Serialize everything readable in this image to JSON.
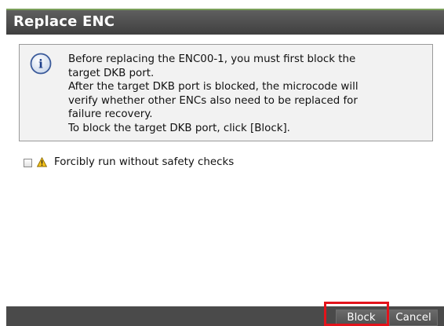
{
  "dialog": {
    "title": "Replace ENC",
    "info_icon": "info-icon",
    "message_lines": [
      "Before replacing the ENC00-1, you must first block the",
      "target DKB port.",
      "After the target DKB port is blocked, the microcode will",
      "verify whether other ENCs also need to be replaced for",
      "failure recovery.",
      "To block the target DKB port, click [Block]."
    ],
    "option": {
      "checked": false,
      "warning_icon": "warning-icon",
      "label": "Forcibly run without safety checks"
    }
  },
  "footer": {
    "block_label": "Block",
    "cancel_label": "Cancel"
  },
  "colors": {
    "title_bar": "#4f4f4f",
    "title_accent": "#7a9f5a",
    "footer": "#4a4a4a",
    "highlight": "#e3131b",
    "info_box_bg": "#f2f2f2"
  }
}
